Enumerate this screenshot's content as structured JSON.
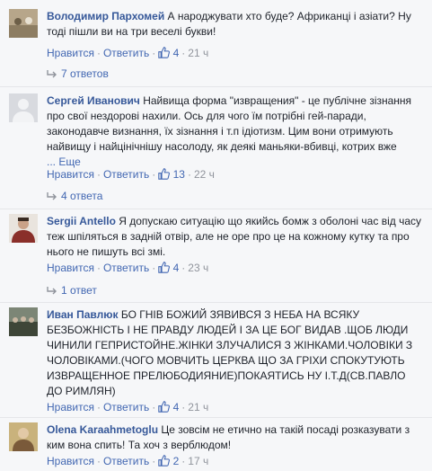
{
  "comments": [
    {
      "author": "Володимир Пархомей",
      "lines": [
        "А народжувати хто буде? Африканці і азіати? Ну",
        "тоді пішли ви на три веселі букви!"
      ],
      "like": "Нравится",
      "reply": "Ответить",
      "likes": "4",
      "time": "21 ч",
      "replies": "7 ответов",
      "avatar_color": "#b7a68a"
    },
    {
      "author": "Сергей Иванович",
      "lines": [
        "Найвища форма \"извращения\" - це публічне зізнання",
        "про свої нездорові нахили. Ось для чого їм потрібні гей-паради,",
        "законодавче визнання, їх зізнання і т.п ідіотизм. Цим вони отримують",
        "найвищу і найцінічнішу насолоду, як деякі маньяки-вбивці, котрих вже"
      ],
      "more": "... Еще",
      "like": "Нравится",
      "reply": "Ответить",
      "likes": "13",
      "time": "22 ч",
      "replies": "4 ответа",
      "avatar_color": "#d8dadf"
    },
    {
      "author": "Sergii Antello",
      "lines": [
        "Я допускаю ситуацію що якийсь бомж з оболоні час від часу",
        "теж шпіляться в задній отвір, але не оре про це на кожному кутку та про",
        "нього не пишуть всі змі."
      ],
      "like": "Нравится",
      "reply": "Ответить",
      "likes": "4",
      "time": "23 ч",
      "replies": "1 ответ",
      "avatar_color": "#8a2f2a"
    },
    {
      "author": "Иван Павлюк",
      "lines": [
        "БО ГНІВ БОЖИЙ ЗЯВИВСЯ З НЕБА НА ВСЯКУ",
        "БЕЗБОЖНІСТЬ І НЕ ПРАВДУ ЛЮДЕЙ І ЗА ЦЕ БОГ ВИДАВ .ЩОБ ЛЮДИ",
        "ЧИНИЛИ ГЕПРИСТОЙНЕ.ЖІНКИ ЗЛУЧАЛИСЯ З ЖІНКАМИ.ЧОЛОВІКИ З",
        "ЧОЛОВІКАМИ.(ЧОГО МОВЧИТЬ ЦЕРКВА ЩО ЗА ГРІХИ СПОКУТУЮТЬ",
        "ИЗВРАЩЕННОЕ ПРЕЛЮБОДИЯНИЕ)ПОКАЯТИСЬ НУ І.Т.Д(СВ.ПАВЛО",
        "ДО РИМЛЯН)"
      ],
      "like": "Нравится",
      "reply": "Ответить",
      "likes": "4",
      "time": "21 ч",
      "avatar_color": "#4f5a4a"
    },
    {
      "author": "Olena Karaahmetoglu",
      "lines": [
        "Це зовсім не етично на такій посаді розказувати з",
        "ким вона спить! Та хоч з верблюдом!"
      ],
      "like": "Нравится",
      "reply": "Ответить",
      "likes": "2",
      "time": "17 ч",
      "avatar_color": "#c9b27c"
    }
  ]
}
